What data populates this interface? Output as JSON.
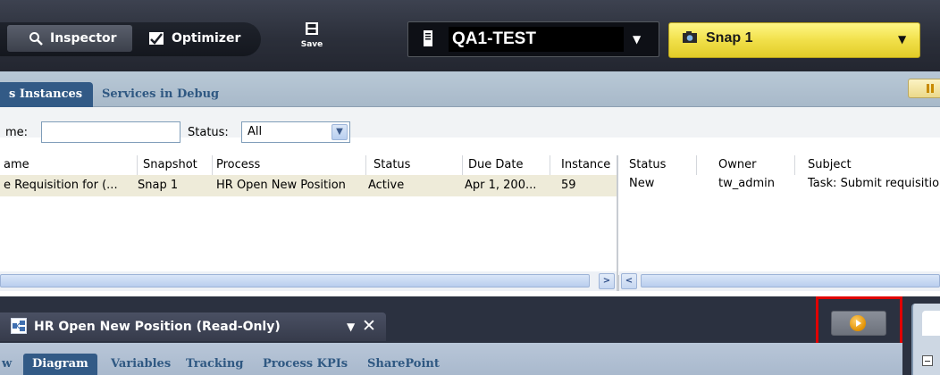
{
  "toolbar": {
    "inspector_label": "Inspector",
    "optimizer_label": "Optimizer",
    "save_label": "Save",
    "server_name": "QA1-TEST",
    "snapshot_label": "Snap 1",
    "snapshot_accent": "#f3e14c"
  },
  "instances_panel": {
    "tabs": [
      "s Instances",
      "Services in Debug"
    ],
    "filter": {
      "name_label": "me:",
      "name_value": "",
      "status_label": "Status:",
      "status_value": "All"
    },
    "instances_table": {
      "columns": [
        "ame",
        "Snapshot",
        "Process",
        "Status",
        "Due Date",
        "Instance"
      ],
      "rows": [
        [
          "e Requisition for (...",
          "Snap 1",
          "HR Open New Position",
          "Active",
          "Apr 1, 200...",
          "59"
        ]
      ]
    },
    "tasks_table": {
      "columns": [
        "Status",
        "Owner",
        "Subject"
      ],
      "rows": [
        [
          "New",
          "tw_admin",
          "Task: Submit requisition"
        ]
      ]
    }
  },
  "process_panel": {
    "title": "HR Open New Position (Read-Only)",
    "subtabs": [
      "w",
      "Diagram",
      "Variables",
      "Tracking",
      "Process KPIs",
      "SharePoint"
    ],
    "active_subtab": "Diagram",
    "highlight_color": "#e00000"
  }
}
